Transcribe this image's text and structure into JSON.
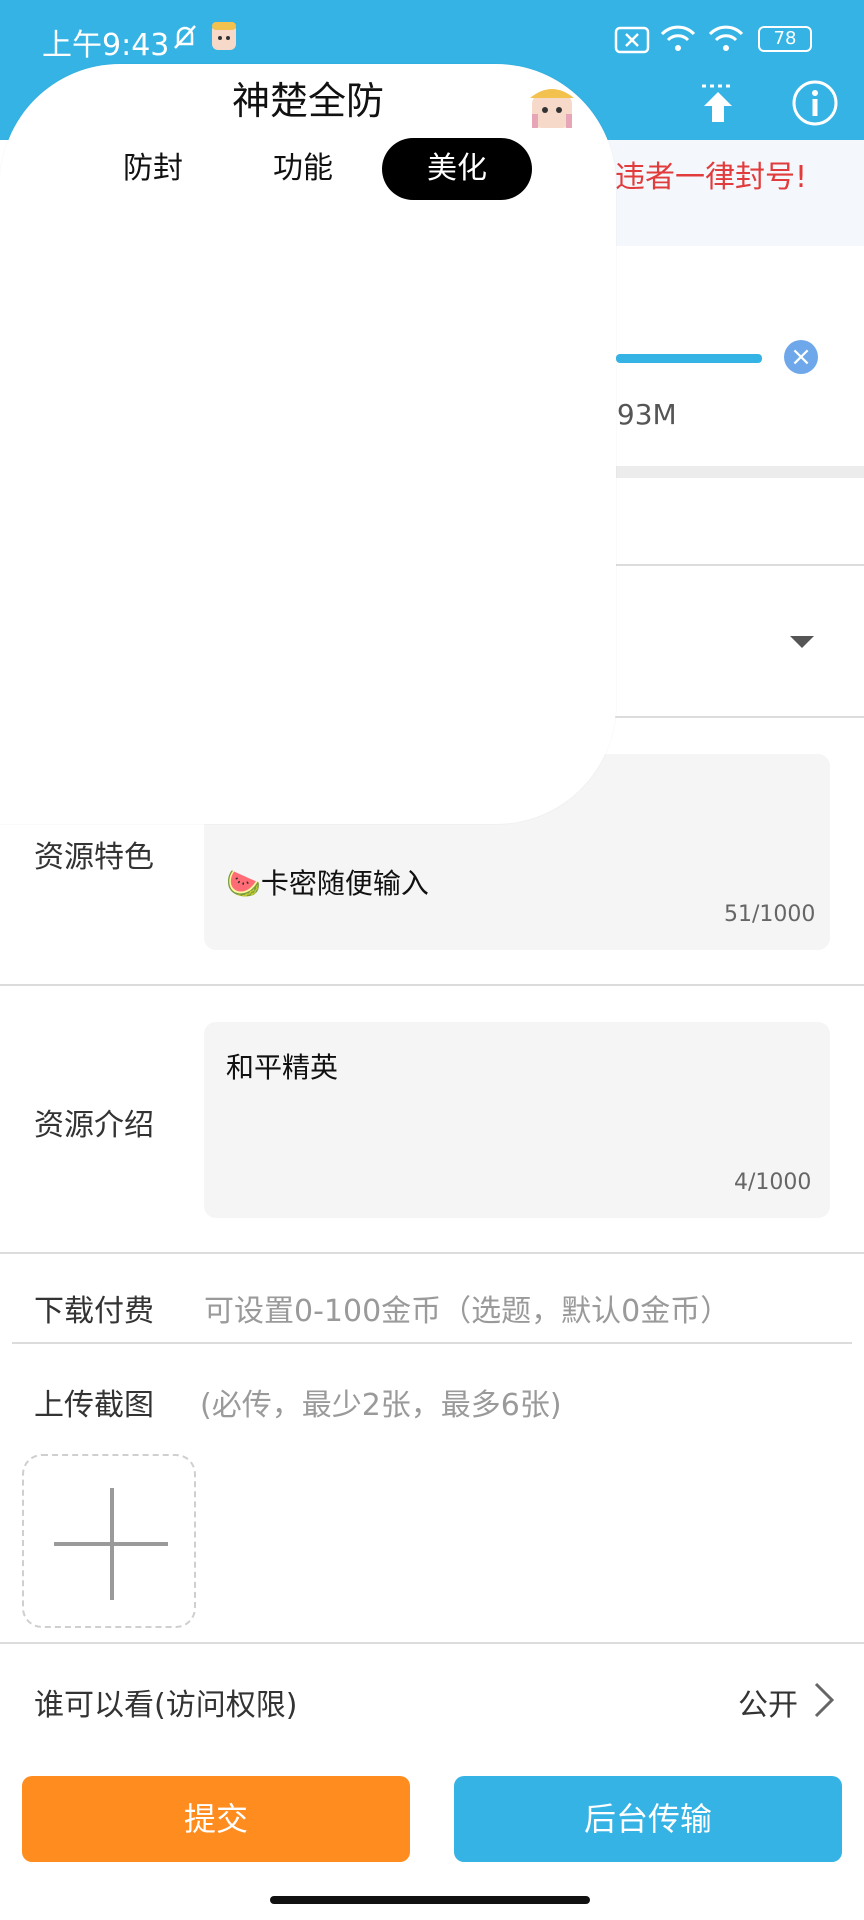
{
  "status_bar": {
    "time": "上午9:43",
    "battery": "78"
  },
  "notice": {
    "text": "违者一律封号!"
  },
  "upload_progress": {
    "size_text": ".93M",
    "fraction": 1.0
  },
  "overlay_panel": {
    "title": "神楚全防",
    "tabs": [
      {
        "label": "防封",
        "active": false
      },
      {
        "label": "功能",
        "active": false
      },
      {
        "label": "美化",
        "active": true
      }
    ]
  },
  "form": {
    "feature": {
      "label": "资源特色",
      "value": "卡密随便输入",
      "emoji": "🍉",
      "counter": "51/1000"
    },
    "intro": {
      "label": "资源介绍",
      "value": "和平精英",
      "counter": "4/1000"
    },
    "fee": {
      "label": "下载付费",
      "placeholder": "可设置0-100金币（选题，默认0金币）"
    },
    "screenshots": {
      "label": "上传截图",
      "hint": "(必传，最少2张，最多6张)"
    },
    "visibility": {
      "label": "谁可以看(访问权限)",
      "value": "公开"
    }
  },
  "actions": {
    "submit": "提交",
    "background": "后台传输"
  },
  "colors": {
    "header": "#35b3e4",
    "submit": "#ff8c1f",
    "background_button": "#35b3e4",
    "notice_text": "#e23b3b"
  },
  "icons": [
    "bell-off-icon",
    "wifi-icon",
    "battery-icon",
    "upload-arrow-icon",
    "info-icon",
    "close-icon",
    "dropdown-caret-icon",
    "plus-icon",
    "chevron-right-icon"
  ]
}
